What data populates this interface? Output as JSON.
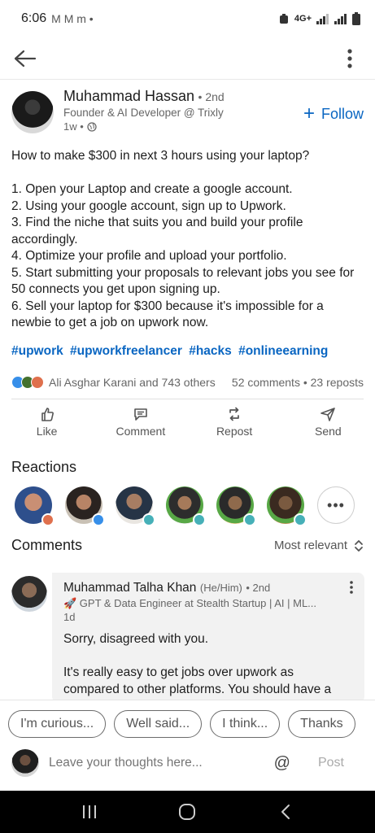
{
  "status_bar": {
    "time": "6:06",
    "notif_icons": "M M m •",
    "network": "4G+"
  },
  "post": {
    "author": {
      "name": "Muhammad Hassan",
      "degree": "• 2nd",
      "headline": "Founder & AI Developer @ Trixly",
      "time": "1w •"
    },
    "follow_label": "Follow",
    "body": "How to make $300 in next 3 hours using your laptop?\n\n1. Open your Laptop and create a google account.\n2. Using your google account, sign up to Upwork.\n3. Find the niche that suits you and build your profile accordingly.\n4. Optimize your profile and upload your portfolio.\n5. Start submitting your proposals to relevant jobs you see for 50 connects you get upon signing up.\n6. Sell your laptop for $300 because it's impossible for a newbie to get a job on upwork now.",
    "hashtags": [
      "#upwork",
      "#upworkfreelancer",
      "#hacks",
      "#onlineearning"
    ],
    "reactions_summary": "Ali Asghar Karani and 743 others",
    "comments_reposts": "52 comments • 23 reposts"
  },
  "actions": [
    {
      "label": "Like",
      "icon": "thumbs-up-icon"
    },
    {
      "label": "Comment",
      "icon": "comment-icon"
    },
    {
      "label": "Repost",
      "icon": "repost-icon"
    },
    {
      "label": "Send",
      "icon": "send-icon"
    }
  ],
  "reactions": {
    "title": "Reactions",
    "more_label": "•••"
  },
  "comments": {
    "title": "Comments",
    "sort_label": "Most relevant",
    "items": [
      {
        "name": "Muhammad Talha Khan",
        "pronouns": "(He/Him)",
        "degree": "• 2nd",
        "headline": "🚀 GPT & Data Engineer at Stealth Startup | AI | ML...",
        "time": "1d",
        "text": "Sorry, disagreed with you.\n\nIt's really easy to get jobs over upwork as compared to other platforms. You should have a really touchy"
      }
    ]
  },
  "suggestions": [
    "I'm curious...",
    "Well said...",
    "I think...",
    "Thanks"
  ],
  "compose": {
    "placeholder": "Leave your thoughts here...",
    "at_label": "@",
    "post_label": "Post"
  },
  "colors": {
    "accent": "#0a66c2",
    "nav_bg": "#000000"
  }
}
